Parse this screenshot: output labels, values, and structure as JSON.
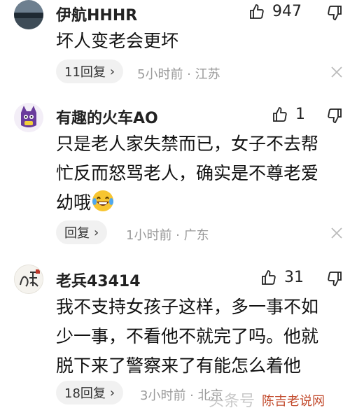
{
  "comments": [
    {
      "username": "伊航HHHR",
      "likes": "947",
      "content": "坏人变老会更坏",
      "reply_label": "11回复",
      "meta": "5小时前 · 江苏"
    },
    {
      "username": "有趣的火车AO",
      "likes": "1",
      "content_line1": "只是老人家失禁而已，女子不去帮",
      "content_line2": "忙反而怒骂老人，确实是不尊老爱",
      "content_line3": "幼哦",
      "reply_label": "回复",
      "meta": "1小时前 · 广东"
    },
    {
      "username": "老兵43414",
      "likes": "31",
      "content_line1": "我不支持女孩子这样，多一事不如",
      "content_line2": "少一事，不看他不就完了吗。他就",
      "content_line3": "脱下来了警察来了有能怎么着他",
      "reply_label": "18回复",
      "meta": "3小时前 · 北京"
    }
  ],
  "watermark": {
    "text1": "头条号",
    "text2": "陈吉老说网"
  },
  "colors": {
    "meta_gray": "#9a9a9a",
    "reply_bg": "#f1f1f1"
  }
}
